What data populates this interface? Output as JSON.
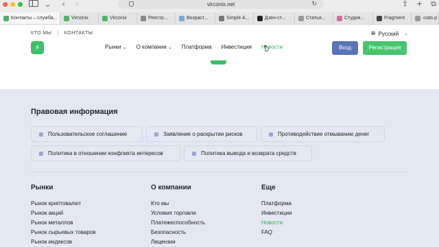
{
  "browser": {
    "url": "virconix.net",
    "tabs": [
      {
        "label": "Контакты – служба...",
        "color": "#4fb26a"
      },
      {
        "label": "Virconix",
        "color": "#4fb26a"
      },
      {
        "label": "Virconix",
        "color": "#4fb26a"
      },
      {
        "label": "Реестр...",
        "color": "#888888"
      },
      {
        "label": "Возраст...",
        "color": "#7aa7d8"
      },
      {
        "label": "Simple A...",
        "color": "#777777"
      },
      {
        "label": "Дзен-ст...",
        "color": "#222222"
      },
      {
        "label": "Статья...",
        "color": "#999999"
      },
      {
        "label": "Студия...",
        "color": "#d86a9a"
      },
      {
        "label": "Fragment",
        "color": "#444444"
      },
      {
        "label": "‹cats.p",
        "color": "#999999"
      }
    ]
  },
  "header": {
    "top_links": [
      "КТО МЫ",
      "КОНТАКТЫ"
    ],
    "separator": "|",
    "language": "Русский",
    "logo_glyph": "⚡",
    "nav": [
      {
        "label": "Рынки",
        "has_dropdown": true
      },
      {
        "label": "О компании",
        "has_dropdown": true
      },
      {
        "label": "Платформа",
        "has_dropdown": false
      },
      {
        "label": "Инвестиции",
        "has_dropdown": false
      },
      {
        "label": "Новости",
        "has_dropdown": false,
        "active": true
      }
    ],
    "login_label": "Вход",
    "register_label": "Регистрация",
    "accent": "#48c46f",
    "login_color": "#5b74b8"
  },
  "legal": {
    "title": "Правовая информация",
    "items": [
      "Пользовательское соглашение",
      "Заявление о раскрытии рисков",
      "Противодействие отмыванию денег",
      "Политика в отношении конфликта интересов",
      "Политика вывода и возврата средств"
    ]
  },
  "footer": {
    "columns": [
      {
        "title": "Рынки",
        "items": [
          "Рынок криптовалют",
          "Рынок акций",
          "Рынок металлов",
          "Рынок сырьевых товаров",
          "Рынок индексов"
        ]
      },
      {
        "title": "О компании",
        "items": [
          "Кто мы",
          "Условия торговли",
          "Платежеспособность",
          "Безопасность",
          "Лицензии"
        ]
      },
      {
        "title": "Еще",
        "items": [
          "Платформа",
          "Инвестиции",
          "Новости",
          "FAQ"
        ],
        "active_index": 2
      }
    ]
  }
}
